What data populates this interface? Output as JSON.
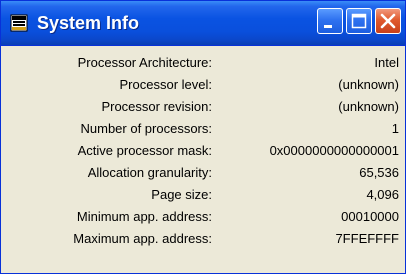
{
  "window": {
    "title": "System Info",
    "icon": "system-info-app-icon",
    "controls": [
      "minimize-icon",
      "maximize-icon",
      "close-icon"
    ]
  },
  "rows": [
    {
      "label": "Processor Architecture:",
      "value": "Intel"
    },
    {
      "label": "Processor level:",
      "value": "(unknown)"
    },
    {
      "label": "Processor revision:",
      "value": "(unknown)"
    },
    {
      "label": "Number of processors:",
      "value": "1"
    },
    {
      "label": "Active processor mask:",
      "value": "0x0000000000000001"
    },
    {
      "label": "Allocation granularity:",
      "value": "65,536"
    },
    {
      "label": "Page size:",
      "value": "4,096"
    },
    {
      "label": "Minimum app. address:",
      "value": "00010000"
    },
    {
      "label": "Maximum app. address:",
      "value": "7FFEFFFF"
    }
  ],
  "colors": {
    "titlebar": "#0a53e2",
    "close_button": "#e05a2e",
    "body": "#ece9d8"
  }
}
